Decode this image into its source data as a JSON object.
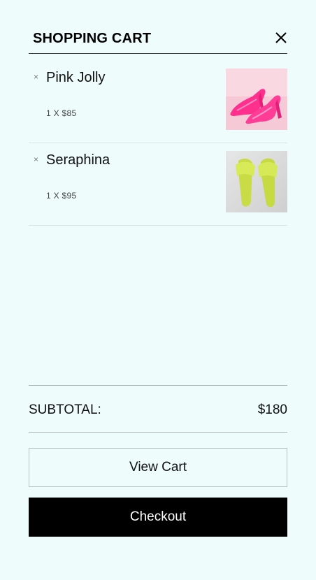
{
  "cart": {
    "title": "SHOPPING CART",
    "close_icon": "close-icon",
    "items": [
      {
        "name": "Pink Jolly",
        "qty_price": "1 X $85",
        "remove_glyph": "×",
        "image": "pink-heels-photo"
      },
      {
        "name": "Seraphina",
        "qty_price": "1 X $95",
        "remove_glyph": "×",
        "image": "yellow-sandals-photo"
      }
    ],
    "subtotal_label": "SUBTOTAL:",
    "subtotal_value": "$180",
    "view_cart_label": "View Cart",
    "checkout_label": "Checkout"
  },
  "colors": {
    "background": "#eefcfc",
    "checkout_bg": "#000000",
    "checkout_text": "#ffffff"
  }
}
